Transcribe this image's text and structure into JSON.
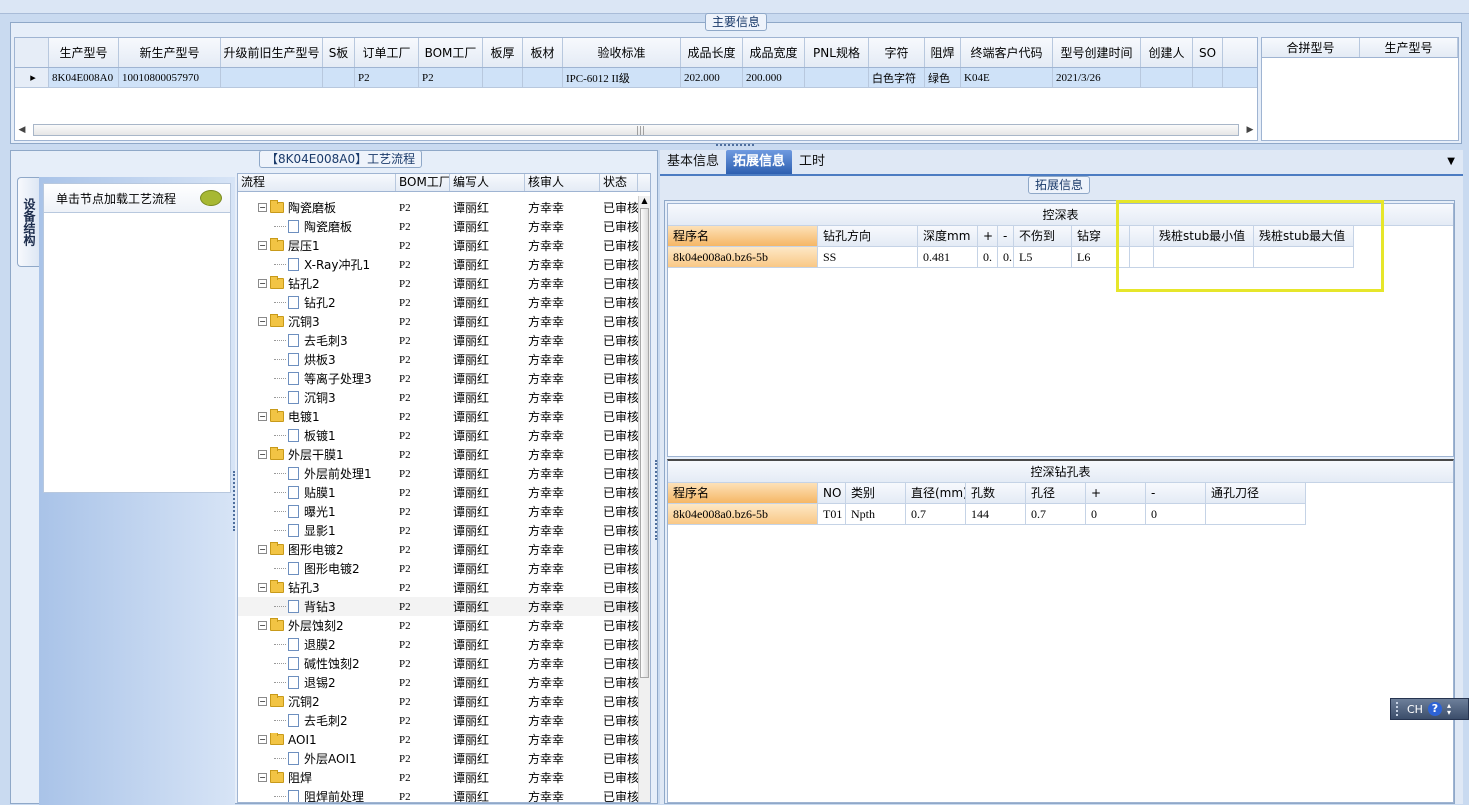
{
  "main_info": {
    "title": "主要信息",
    "columns": [
      "生产型号",
      "新生产型号",
      "升级前旧生产型号",
      "S板",
      "订单工厂",
      "BOM工厂",
      "板厚",
      "板材",
      "验收标准",
      "成品长度",
      "成品宽度",
      "PNL规格",
      "字符",
      "阻焊",
      "终端客户代码",
      "型号创建时间",
      "创建人",
      "SO"
    ],
    "row": [
      "8K04E008A0",
      "10010800057970",
      "",
      "",
      "P2",
      "P2",
      "",
      "",
      "IPC-6012 II级",
      "202.000",
      "200.000",
      "",
      "白色字符",
      "绿色",
      "K04E",
      "2021/3/26",
      "",
      ""
    ],
    "merge_columns": [
      "合拼型号",
      "生产型号"
    ]
  },
  "flow_panel": {
    "title": "【8K04E008A0】工艺流程",
    "side_tab": "设备结构",
    "load_hint": "单击节点加载工艺流程",
    "columns": [
      "流程",
      "BOM工厂",
      "编写人",
      "核审人",
      "状态"
    ],
    "rows": [
      {
        "level": 1,
        "name": "陶瓷磨板",
        "bom": "P2",
        "writer": "谭丽红",
        "reviewer": "方幸幸",
        "status": "已审核"
      },
      {
        "level": 2,
        "name": "陶瓷磨板",
        "bom": "P2",
        "writer": "谭丽红",
        "reviewer": "方幸幸",
        "status": "已审核"
      },
      {
        "level": 1,
        "name": "层压1",
        "bom": "P2",
        "writer": "谭丽红",
        "reviewer": "方幸幸",
        "status": "已审核"
      },
      {
        "level": 2,
        "name": "X-Ray冲孔1",
        "bom": "P2",
        "writer": "谭丽红",
        "reviewer": "方幸幸",
        "status": "已审核"
      },
      {
        "level": 1,
        "name": "钻孔2",
        "bom": "P2",
        "writer": "谭丽红",
        "reviewer": "方幸幸",
        "status": "已审核"
      },
      {
        "level": 2,
        "name": "钻孔2",
        "bom": "P2",
        "writer": "谭丽红",
        "reviewer": "方幸幸",
        "status": "已审核"
      },
      {
        "level": 1,
        "name": "沉铜3",
        "bom": "P2",
        "writer": "谭丽红",
        "reviewer": "方幸幸",
        "status": "已审核"
      },
      {
        "level": 2,
        "name": "去毛刺3",
        "bom": "P2",
        "writer": "谭丽红",
        "reviewer": "方幸幸",
        "status": "已审核"
      },
      {
        "level": 2,
        "name": "烘板3",
        "bom": "P2",
        "writer": "谭丽红",
        "reviewer": "方幸幸",
        "status": "已审核"
      },
      {
        "level": 2,
        "name": "等离子处理3",
        "bom": "P2",
        "writer": "谭丽红",
        "reviewer": "方幸幸",
        "status": "已审核"
      },
      {
        "level": 2,
        "name": "沉铜3",
        "bom": "P2",
        "writer": "谭丽红",
        "reviewer": "方幸幸",
        "status": "已审核"
      },
      {
        "level": 1,
        "name": "电镀1",
        "bom": "P2",
        "writer": "谭丽红",
        "reviewer": "方幸幸",
        "status": "已审核"
      },
      {
        "level": 2,
        "name": "板镀1",
        "bom": "P2",
        "writer": "谭丽红",
        "reviewer": "方幸幸",
        "status": "已审核"
      },
      {
        "level": 1,
        "name": "外层干膜1",
        "bom": "P2",
        "writer": "谭丽红",
        "reviewer": "方幸幸",
        "status": "已审核"
      },
      {
        "level": 2,
        "name": "外层前处理1",
        "bom": "P2",
        "writer": "谭丽红",
        "reviewer": "方幸幸",
        "status": "已审核"
      },
      {
        "level": 2,
        "name": "贴膜1",
        "bom": "P2",
        "writer": "谭丽红",
        "reviewer": "方幸幸",
        "status": "已审核"
      },
      {
        "level": 2,
        "name": "曝光1",
        "bom": "P2",
        "writer": "谭丽红",
        "reviewer": "方幸幸",
        "status": "已审核"
      },
      {
        "level": 2,
        "name": "显影1",
        "bom": "P2",
        "writer": "谭丽红",
        "reviewer": "方幸幸",
        "status": "已审核"
      },
      {
        "level": 1,
        "name": "图形电镀2",
        "bom": "P2",
        "writer": "谭丽红",
        "reviewer": "方幸幸",
        "status": "已审核"
      },
      {
        "level": 2,
        "name": "图形电镀2",
        "bom": "P2",
        "writer": "谭丽红",
        "reviewer": "方幸幸",
        "status": "已审核"
      },
      {
        "level": 1,
        "name": "钻孔3",
        "bom": "P2",
        "writer": "谭丽红",
        "reviewer": "方幸幸",
        "status": "已审核"
      },
      {
        "level": 2,
        "name": "背钻3",
        "bom": "P2",
        "writer": "谭丽红",
        "reviewer": "方幸幸",
        "status": "已审核",
        "selected": true
      },
      {
        "level": 1,
        "name": "外层蚀刻2",
        "bom": "P2",
        "writer": "谭丽红",
        "reviewer": "方幸幸",
        "status": "已审核"
      },
      {
        "level": 2,
        "name": "退膜2",
        "bom": "P2",
        "writer": "谭丽红",
        "reviewer": "方幸幸",
        "status": "已审核"
      },
      {
        "level": 2,
        "name": "碱性蚀刻2",
        "bom": "P2",
        "writer": "谭丽红",
        "reviewer": "方幸幸",
        "status": "已审核"
      },
      {
        "level": 2,
        "name": "退锡2",
        "bom": "P2",
        "writer": "谭丽红",
        "reviewer": "方幸幸",
        "status": "已审核"
      },
      {
        "level": 1,
        "name": "沉铜2",
        "bom": "P2",
        "writer": "谭丽红",
        "reviewer": "方幸幸",
        "status": "已审核"
      },
      {
        "level": 2,
        "name": "去毛刺2",
        "bom": "P2",
        "writer": "谭丽红",
        "reviewer": "方幸幸",
        "status": "已审核"
      },
      {
        "level": 1,
        "name": "AOI1",
        "bom": "P2",
        "writer": "谭丽红",
        "reviewer": "方幸幸",
        "status": "已审核"
      },
      {
        "level": 2,
        "name": "外层AOI1",
        "bom": "P2",
        "writer": "谭丽红",
        "reviewer": "方幸幸",
        "status": "已审核"
      },
      {
        "level": 1,
        "name": "阻焊",
        "bom": "P2",
        "writer": "谭丽红",
        "reviewer": "方幸幸",
        "status": "已审核"
      },
      {
        "level": 2,
        "name": "阻焊前处理",
        "bom": "P2",
        "writer": "谭丽红",
        "reviewer": "方幸幸",
        "status": "已审核"
      }
    ]
  },
  "tabs": [
    "基本信息",
    "拓展信息",
    "工时"
  ],
  "active_tab": 1,
  "extension": {
    "title": "拓展信息",
    "depth_table": {
      "caption": "控深表",
      "columns": [
        "程序名",
        "钻孔方向",
        "深度mm",
        "+",
        "-",
        "不伤到",
        "钻穿",
        "",
        "残桩stub最小值",
        "残桩stub最大值"
      ],
      "row": [
        "8k04e008a0.bz6-5b",
        "SS",
        "0.481",
        "0.",
        "0.",
        "L5",
        "L6",
        "",
        "",
        ""
      ]
    },
    "drill_table": {
      "caption": "控深钻孔表",
      "columns": [
        "程序名",
        "NO",
        "类别",
        "直径(mm)",
        "孔数",
        "孔径",
        "+",
        "-",
        "通孔刀径"
      ],
      "row": [
        "8k04e008a0.bz6-5b",
        "T01",
        "Npth",
        "0.7",
        "144",
        "0.7",
        "0",
        "0",
        ""
      ]
    }
  },
  "ime": {
    "lang": "CH",
    "help": "?"
  }
}
